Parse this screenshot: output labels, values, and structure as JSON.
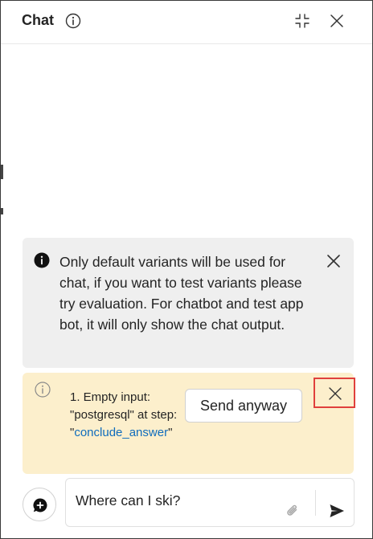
{
  "header": {
    "title": "Chat",
    "info_icon": "info-circle-icon",
    "collapse_icon": "collapse-icon",
    "close_icon": "close-icon"
  },
  "info_banner": {
    "icon": "info-filled-icon",
    "text": "Only default variants will be used for chat, if you want to test variants please try evaluation. For chatbot and test app bot, it will only show the chat output.",
    "close_icon": "close-icon"
  },
  "warning_banner": {
    "icon": "info-circle-icon",
    "message_prefix": "1. Empty input: \"postgresql\" at step: \"",
    "message_link": "conclude_answer",
    "message_suffix": "\"",
    "button_label": "Send anyway",
    "close_icon": "close-icon",
    "background": "#fcefcc",
    "highlight_color": "#e0403c"
  },
  "composer": {
    "new_chat_icon": "chat-add-icon",
    "input_value": "Where can I ski?",
    "attach_icon": "paperclip-icon",
    "send_icon": "send-icon"
  },
  "colors": {
    "link": "#0f6cbd",
    "info_background": "#efefef"
  }
}
